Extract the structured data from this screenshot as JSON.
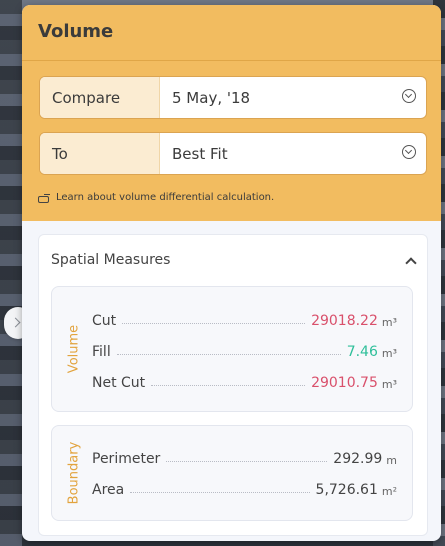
{
  "panel": {
    "title": "Volume",
    "compare": {
      "label": "Compare",
      "value": "5 May, '18"
    },
    "to": {
      "label": "To",
      "value": "Best Fit"
    },
    "learn_link": "Learn about volume differential calculation.",
    "spatial": {
      "title": "Spatial Measures",
      "volume": {
        "label": "Volume",
        "rows": [
          {
            "name": "Cut",
            "value": "29018.22",
            "unit": "m³",
            "color": "#d9506b"
          },
          {
            "name": "Fill",
            "value": "7.46",
            "unit": "m³",
            "color": "#2fbf9a"
          },
          {
            "name": "Net Cut",
            "value": "29010.75",
            "unit": "m³",
            "color": "#d9506b"
          }
        ]
      },
      "boundary": {
        "label": "Boundary",
        "rows": [
          {
            "name": "Perimeter",
            "value": "292.99",
            "unit": "m"
          },
          {
            "name": "Area",
            "value": "5,726.61",
            "unit": "m²"
          }
        ]
      }
    }
  },
  "icons": {
    "dropdown": "chevron-down-circle-icon",
    "collapse": "chevron-up-icon",
    "learn": "hand-pointer-icon",
    "side_toggle": "chevron-right-icon"
  }
}
